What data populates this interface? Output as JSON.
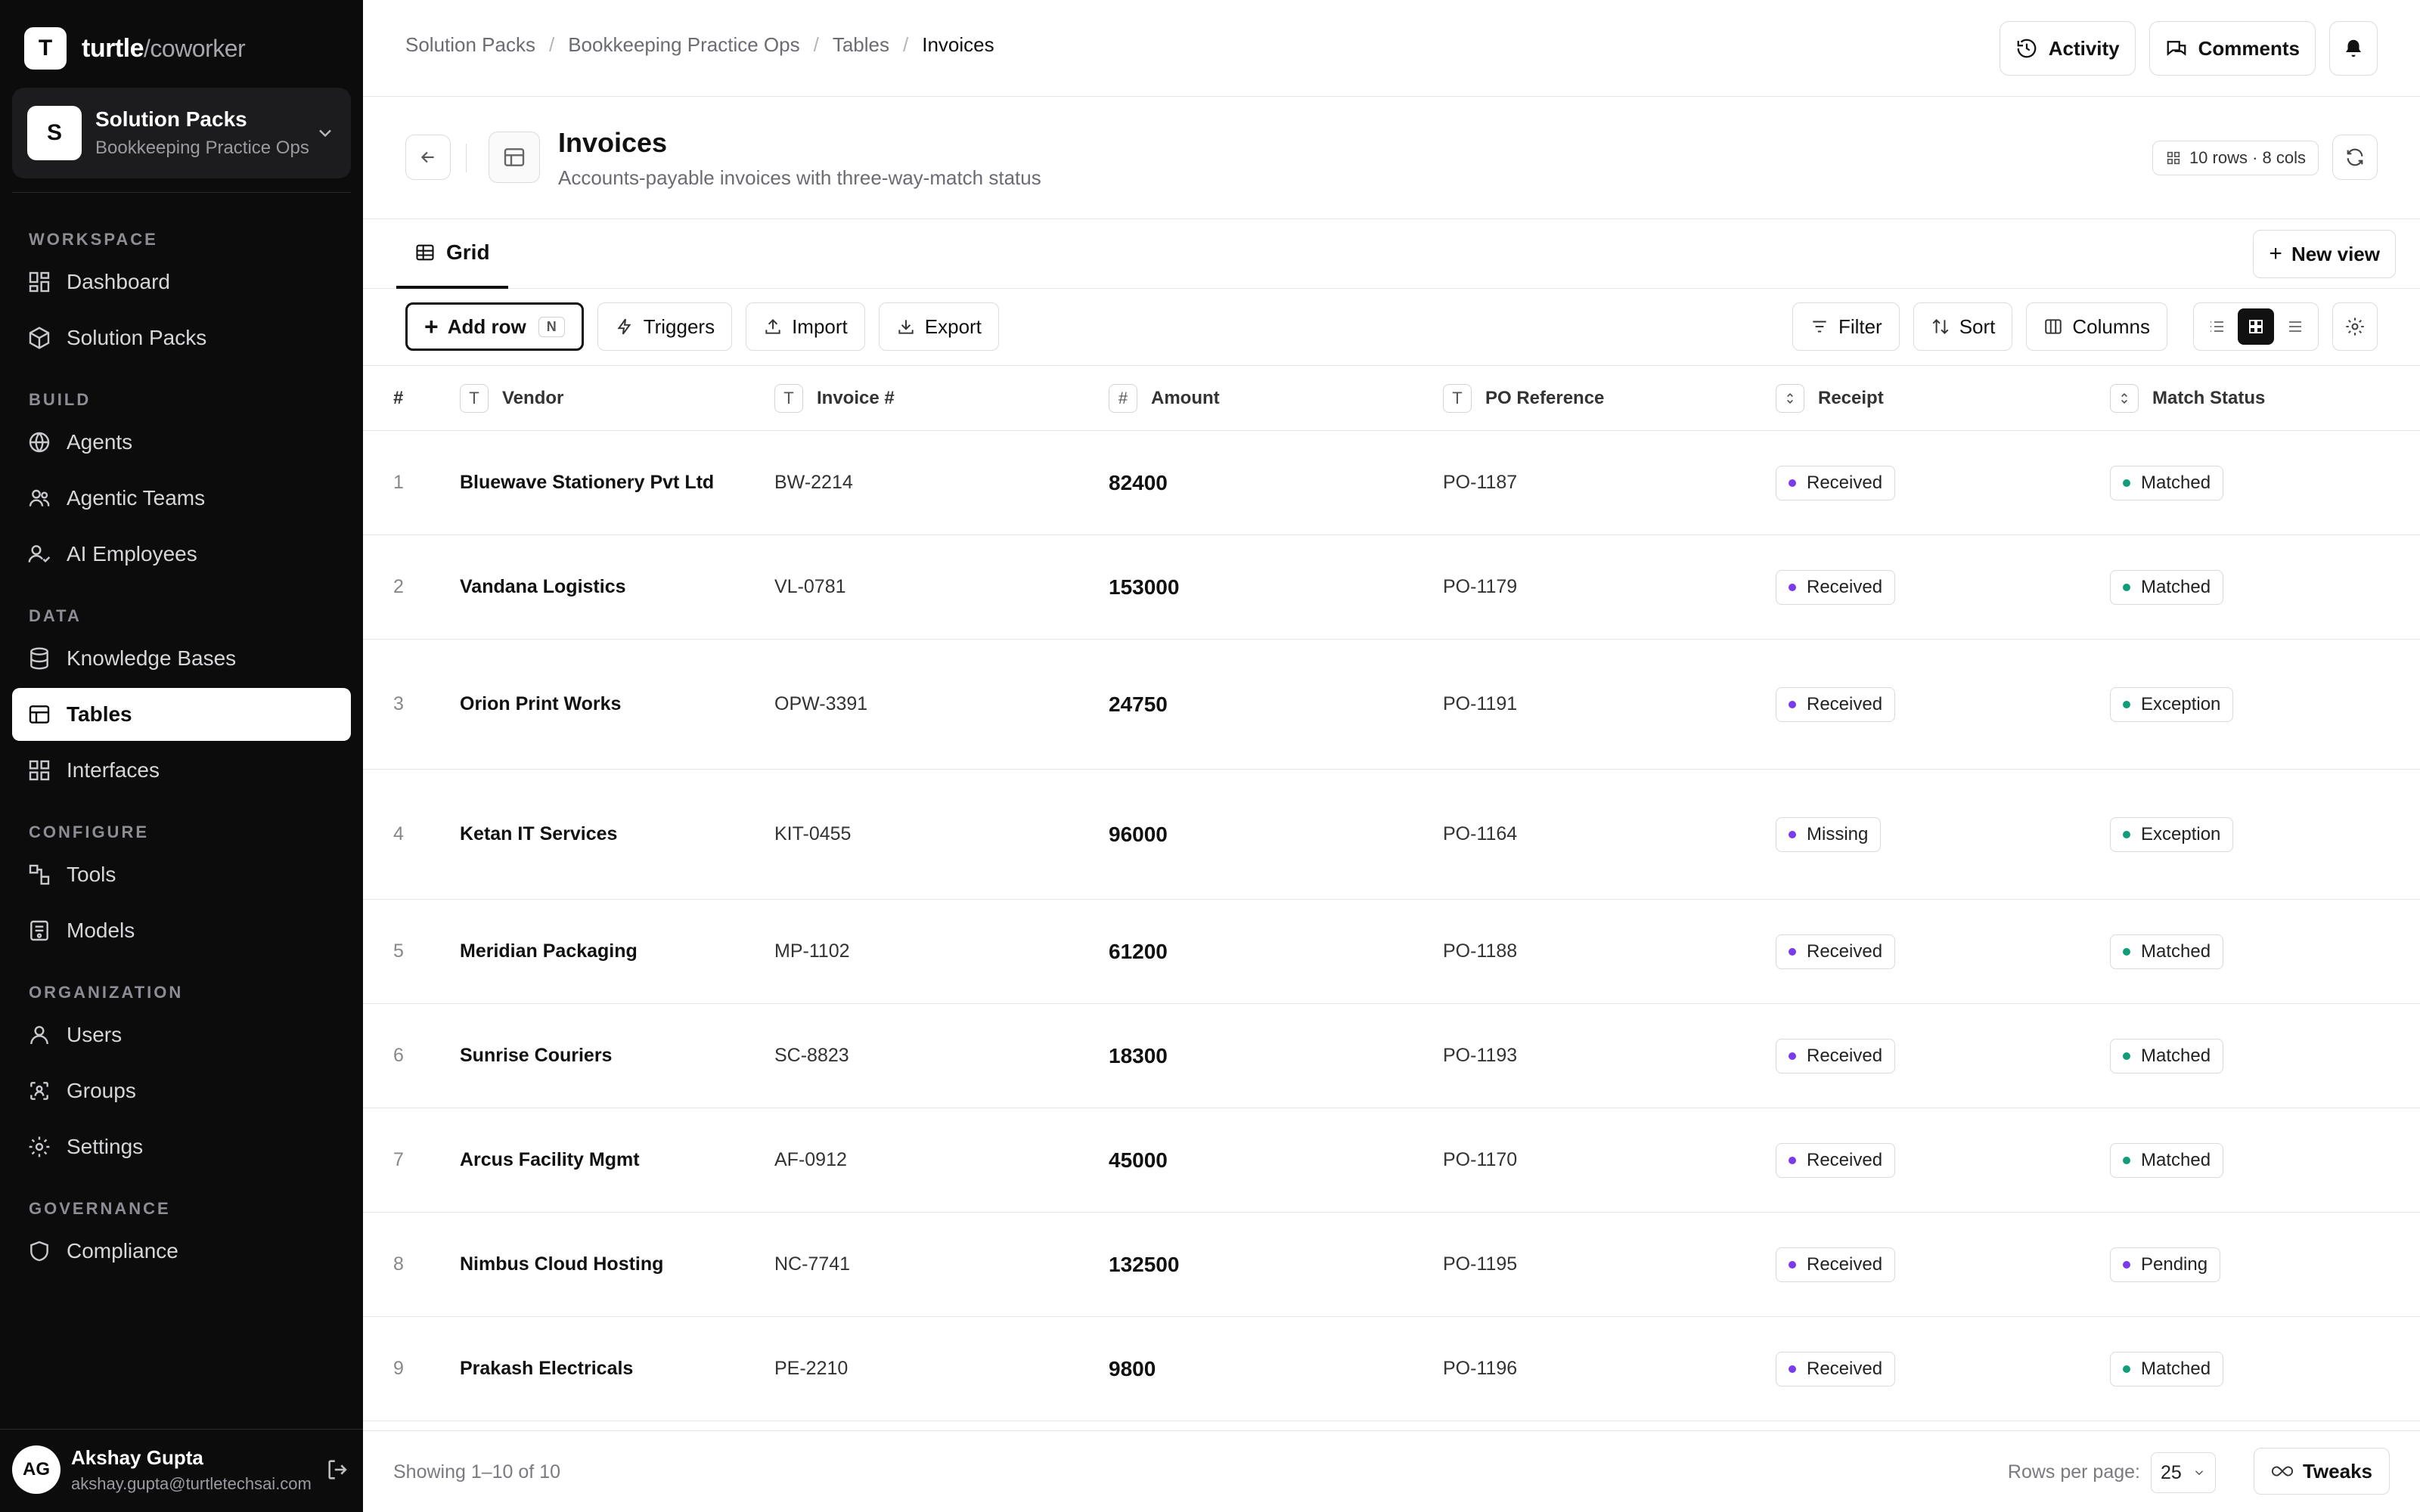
{
  "brand": {
    "logo_letter": "T",
    "name": "turtle",
    "suffix": "/coworker"
  },
  "workspace": {
    "avatar_letter": "S",
    "title": "Solution Packs",
    "subtitle": "Bookkeeping Practice Ops"
  },
  "sidebar": {
    "sections": [
      {
        "label": "WORKSPACE",
        "items": [
          {
            "label": "Dashboard",
            "icon": "dashboard-icon"
          },
          {
            "label": "Solution Packs",
            "icon": "package-icon"
          }
        ]
      },
      {
        "label": "BUILD",
        "items": [
          {
            "label": "Agents",
            "icon": "globe-icon"
          },
          {
            "label": "Agentic Teams",
            "icon": "team-icon"
          },
          {
            "label": "AI Employees",
            "icon": "user-check-icon"
          }
        ]
      },
      {
        "label": "DATA",
        "items": [
          {
            "label": "Knowledge Bases",
            "icon": "database-icon"
          },
          {
            "label": "Tables",
            "icon": "table-icon",
            "active": true
          },
          {
            "label": "Interfaces",
            "icon": "layout-icon"
          }
        ]
      },
      {
        "label": "CONFIGURE",
        "items": [
          {
            "label": "Tools",
            "icon": "tools-icon"
          },
          {
            "label": "Models",
            "icon": "model-icon"
          }
        ]
      },
      {
        "label": "ORGANIZATION",
        "items": [
          {
            "label": "Users",
            "icon": "user-icon"
          },
          {
            "label": "Groups",
            "icon": "groups-icon"
          },
          {
            "label": "Settings",
            "icon": "gear-icon"
          }
        ]
      },
      {
        "label": "GOVERNANCE",
        "items": [
          {
            "label": "Compliance",
            "icon": "shield-icon"
          }
        ]
      }
    ]
  },
  "user": {
    "initials": "AG",
    "name": "Akshay Gupta",
    "email": "akshay.gupta@turtletechsai.com"
  },
  "breadcrumb": [
    "Solution Packs",
    "Bookkeeping Practice Ops",
    "Tables",
    "Invoices"
  ],
  "top_actions": {
    "activity": "Activity",
    "comments": "Comments"
  },
  "page": {
    "title": "Invoices",
    "description": "Accounts-payable invoices with three-way-match status",
    "meta": "10 rows · 8 cols"
  },
  "tabs": [
    {
      "label": "Grid"
    }
  ],
  "new_view_label": "New view",
  "toolbar": {
    "add_row": "Add row",
    "add_row_shortcut": "N",
    "triggers": "Triggers",
    "import": "Import",
    "export": "Export",
    "filter": "Filter",
    "sort": "Sort",
    "columns": "Columns"
  },
  "columns": [
    {
      "label": "#",
      "type": ""
    },
    {
      "label": "Vendor",
      "type": "T"
    },
    {
      "label": "Invoice #",
      "type": "T"
    },
    {
      "label": "Amount",
      "type": "#"
    },
    {
      "label": "PO Reference",
      "type": "T"
    },
    {
      "label": "Receipt",
      "type": "select"
    },
    {
      "label": "Match Status",
      "type": "select"
    }
  ],
  "rows": [
    {
      "n": "1",
      "vendor": "Bluewave Stationery Pvt Ltd",
      "invoice": "BW-2214",
      "amount": "82400",
      "po": "PO-1187",
      "receipt": "Received",
      "status": "Matched"
    },
    {
      "n": "2",
      "vendor": "Vandana Logistics",
      "invoice": "VL-0781",
      "amount": "153000",
      "po": "PO-1179",
      "receipt": "Received",
      "status": "Matched"
    },
    {
      "n": "3",
      "vendor": "Orion Print Works",
      "invoice": "OPW-3391",
      "amount": "24750",
      "po": "PO-1191",
      "receipt": "Received",
      "status": "Exception"
    },
    {
      "n": "4",
      "vendor": "Ketan IT Services",
      "invoice": "KIT-0455",
      "amount": "96000",
      "po": "PO-1164",
      "receipt": "Missing",
      "status": "Exception"
    },
    {
      "n": "5",
      "vendor": "Meridian Packaging",
      "invoice": "MP-1102",
      "amount": "61200",
      "po": "PO-1188",
      "receipt": "Received",
      "status": "Matched"
    },
    {
      "n": "6",
      "vendor": "Sunrise Couriers",
      "invoice": "SC-8823",
      "amount": "18300",
      "po": "PO-1193",
      "receipt": "Received",
      "status": "Matched"
    },
    {
      "n": "7",
      "vendor": "Arcus Facility Mgmt",
      "invoice": "AF-0912",
      "amount": "45000",
      "po": "PO-1170",
      "receipt": "Received",
      "status": "Matched"
    },
    {
      "n": "8",
      "vendor": "Nimbus Cloud Hosting",
      "invoice": "NC-7741",
      "amount": "132500",
      "po": "PO-1195",
      "receipt": "Received",
      "status": "Pending"
    },
    {
      "n": "9",
      "vendor": "Prakash Electricals",
      "invoice": "PE-2210",
      "amount": "9800",
      "po": "PO-1196",
      "receipt": "Received",
      "status": "Matched"
    }
  ],
  "colors": {
    "receipt_dot": "#7c3aed",
    "matched_dot": "#0f9d7a",
    "exception_dot": "#0f9d7a",
    "pending_dot": "#7c3aed"
  },
  "footer": {
    "showing": "Showing 1–10 of 10",
    "rows_per_page_label": "Rows per page:",
    "rows_per_page": "25",
    "tweaks": "Tweaks"
  }
}
